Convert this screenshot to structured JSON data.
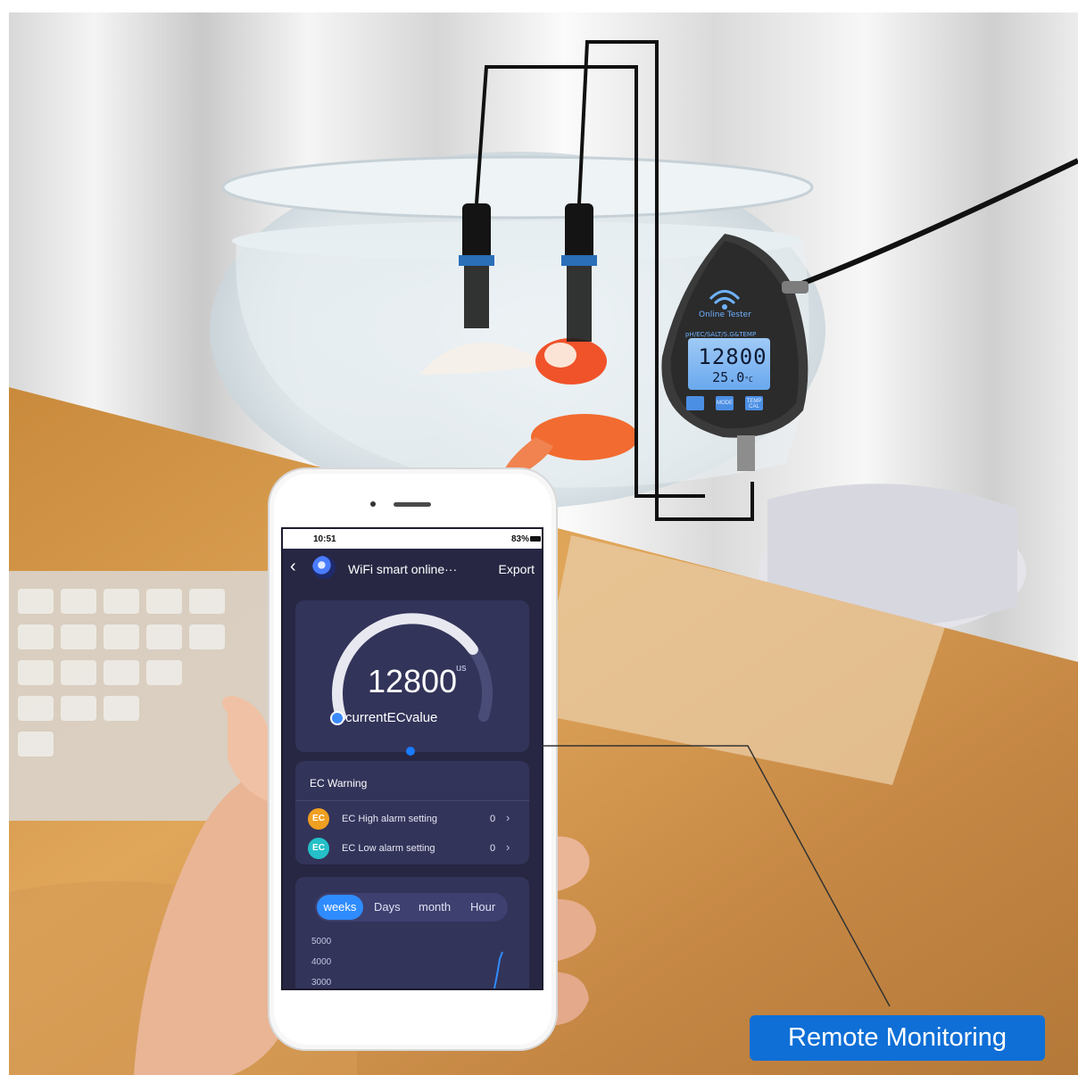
{
  "colors": {
    "accent": "#2f8cff",
    "app_background": "#272744",
    "card_background": "#33345a",
    "label_background": "#0f6fd6",
    "ec_high_badge": "#f0a021",
    "ec_low_badge": "#24c0c8"
  },
  "tester": {
    "brand_label": "Online Tester",
    "modes_label": "pH/EC/SALT/S.G&TEMP",
    "main_reading": "12800",
    "temperature_reading": "25.0",
    "temperature_unit": "°C",
    "buttons": [
      "",
      "MODE",
      "TEMP CAL"
    ]
  },
  "phone": {
    "status_bar": {
      "time_icons": "10:51",
      "battery": "83%"
    },
    "header": {
      "back_icon": "chevron-left-icon",
      "title": "WiFi smart  online···",
      "export_label": "Export"
    },
    "gauge": {
      "value": "12800",
      "unit": "us",
      "label": "currentECvalue",
      "level": 0.75
    },
    "warning": {
      "title": "EC Warning",
      "items": [
        {
          "badge": "EC",
          "label": "EC High alarm setting",
          "value": "0"
        },
        {
          "badge": "EC",
          "label": "EC Low alarm setting",
          "value": "0"
        }
      ]
    },
    "chart": {
      "tabs": [
        "weeks",
        "Days",
        "month",
        "Hour"
      ],
      "active_tab": "weeks",
      "yticks": [
        "5000",
        "4000",
        "3000"
      ]
    }
  },
  "remote_label": "Remote Monitoring"
}
